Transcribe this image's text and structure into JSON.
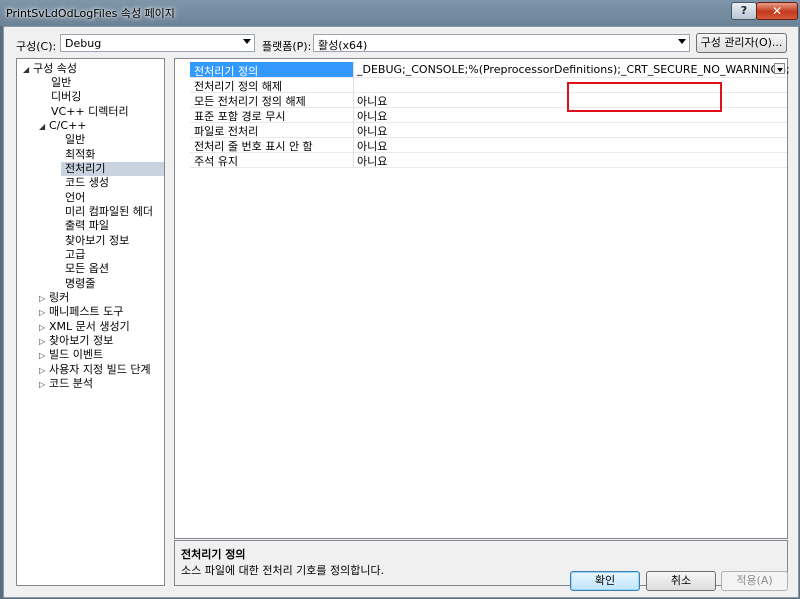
{
  "window": {
    "title": "PrintSvLdOdLogFiles 속성 페이지",
    "help_label": "?",
    "close_label": "✕"
  },
  "config": {
    "config_label": "구성(C):",
    "config_value": "Debug",
    "platform_label": "플랫폼(P):",
    "platform_value": "활성(x64)",
    "manager_button": "구성 관리자(O)..."
  },
  "tree": {
    "root": "구성 속성",
    "items": [
      {
        "label": "일반"
      },
      {
        "label": "디버깅"
      },
      {
        "label": "VC++ 디렉터리"
      },
      {
        "label": "C/C++"
      },
      {
        "label": "일반"
      },
      {
        "label": "최적화"
      },
      {
        "label": "전처리기"
      },
      {
        "label": "코드 생성"
      },
      {
        "label": "언어"
      },
      {
        "label": "미리 컴파일된 헤더"
      },
      {
        "label": "출력 파일"
      },
      {
        "label": "찾아보기 정보"
      },
      {
        "label": "고급"
      },
      {
        "label": "모든 옵션"
      },
      {
        "label": "명령줄"
      },
      {
        "label": "링커"
      },
      {
        "label": "매니페스트 도구"
      },
      {
        "label": "XML 문서 생성기"
      },
      {
        "label": "찾아보기 정보"
      },
      {
        "label": "빌드 이벤트"
      },
      {
        "label": "사용자 지정 빌드 단계"
      },
      {
        "label": "코드 분석"
      }
    ]
  },
  "grid": {
    "rows": [
      {
        "name": "전처리기 정의",
        "value": "_DEBUG;_CONSOLE;%(PreprocessorDefinitions);_CRT_SECURE_NO_WARNINGS;"
      },
      {
        "name": "전처리기 정의 해제",
        "value": ""
      },
      {
        "name": "모든 전처리기 정의 해제",
        "value": "아니요"
      },
      {
        "name": "표준 포함 경로 무시",
        "value": "아니요"
      },
      {
        "name": "파일로 전처리",
        "value": "아니요"
      },
      {
        "name": "전처리 줄 번호 표시 안 함",
        "value": "아니요"
      },
      {
        "name": "주석 유지",
        "value": "아니요"
      }
    ]
  },
  "description": {
    "title": "전처리기 정의",
    "text": "소스 파일에 대한 전처리 기호를 정의합니다."
  },
  "buttons": {
    "ok": "확인",
    "cancel": "취소",
    "apply": "적용(A)"
  },
  "colors": {
    "selection": "#3399ff",
    "highlight_box": "#e0101a"
  }
}
